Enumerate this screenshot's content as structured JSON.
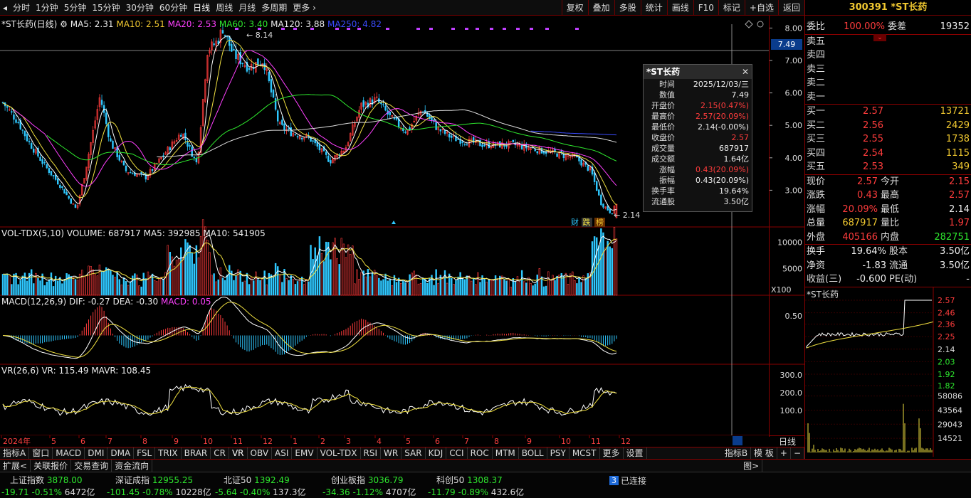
{
  "toolbar": {
    "periods": [
      "分时",
      "1分钟",
      "5分钟",
      "15分钟",
      "30分钟",
      "60分钟",
      "日线",
      "周线",
      "月线",
      "多周期",
      "更多"
    ],
    "actions": [
      "复权",
      "叠加",
      "多股",
      "统计",
      "画线",
      "F10",
      "标记",
      "+自选",
      "返回"
    ]
  },
  "chart_title": {
    "name": "*ST长药(日线)",
    "ma5": "MA5: 2.31",
    "ma10": "MA10: 2.51",
    "ma20": "MA20: 2.53",
    "ma60": "MA60: 3.40",
    "ma120": "MA120: 3.88",
    "ma250": "MA250: 4.82",
    "high_mark": "8.14",
    "low_mark": "2.14"
  },
  "price_axis": [
    "8.00",
    "7.00",
    "6.00",
    "5.00",
    "4.00",
    "3.00"
  ],
  "cursor_price": "7.49",
  "volume_label": {
    "name": "VOL-TDX(5,10)",
    "volume": "VOLUME: 687917",
    "ma5": "MA5: 392985",
    "ma10": "MA10: 541905"
  },
  "volume_axis": [
    "10000",
    "5000",
    "X100"
  ],
  "macd_label": {
    "name": "MACD(12,26,9)",
    "dif": "DIF: -0.27",
    "dea": "DEA: -0.30",
    "macd": "MACD: 0.05"
  },
  "macd_axis": [
    "0.50"
  ],
  "vr_label": {
    "name": "VR(26,6)",
    "vr": "VR: 115.49",
    "mavr": "MAVR: 108.45"
  },
  "vr_axis": [
    "300.0",
    "200.0",
    "100.0"
  ],
  "months": [
    "2024年",
    "5",
    "6",
    "7",
    "8",
    "9",
    "10",
    "11",
    "12",
    "1",
    "2",
    "3",
    "4",
    "5",
    "6",
    "7",
    "8",
    "9",
    "10",
    "11",
    "12"
  ],
  "period_badge": "日线",
  "event_badges": [
    "财",
    "跌",
    "榜"
  ],
  "tooltip": {
    "title": "*ST长药",
    "rows": [
      {
        "k": "时间",
        "v": "2025/12/03/三",
        "c": "white"
      },
      {
        "k": "数值",
        "v": "7.49",
        "c": "white"
      },
      {
        "k": "开盘价",
        "v": "2.15(0.47%)",
        "c": "red"
      },
      {
        "k": "最高价",
        "v": "2.57(20.09%)",
        "c": "red"
      },
      {
        "k": "最低价",
        "v": "2.14(-0.00%)",
        "c": "white"
      },
      {
        "k": "收盘价",
        "v": "2.57",
        "c": "red"
      },
      {
        "k": "成交量",
        "v": "687917",
        "c": "white"
      },
      {
        "k": "成交额",
        "v": "1.64亿",
        "c": "white"
      },
      {
        "k": "涨幅",
        "v": "0.43(20.09%)",
        "c": "red"
      },
      {
        "k": "振幅",
        "v": "0.43(20.09%)",
        "c": "white"
      },
      {
        "k": "换手率",
        "v": "19.64%",
        "c": "white"
      },
      {
        "k": "流通股",
        "v": "3.50亿",
        "c": "white"
      }
    ]
  },
  "quote": {
    "header": "300391 *ST长药",
    "weibi_label": "委比",
    "weibi": "100.00%",
    "weicha_label": "委差",
    "weicha": "19352",
    "sells": [
      "卖五",
      "卖四",
      "卖三",
      "卖二",
      "卖一"
    ],
    "buys": [
      {
        "l": "买一",
        "p": "2.57",
        "v": "13721"
      },
      {
        "l": "买二",
        "p": "2.56",
        "v": "2429"
      },
      {
        "l": "买三",
        "p": "2.55",
        "v": "1738"
      },
      {
        "l": "买四",
        "p": "2.54",
        "v": "1115"
      },
      {
        "l": "买五",
        "p": "2.53",
        "v": "349"
      }
    ],
    "stats": [
      {
        "l1": "现价",
        "v1": "2.57",
        "c1": "red",
        "l2": "今开",
        "v2": "2.15",
        "c2": "red"
      },
      {
        "l1": "涨跌",
        "v1": "0.43",
        "c1": "red",
        "l2": "最高",
        "v2": "2.57",
        "c2": "red"
      },
      {
        "l1": "涨幅",
        "v1": "20.09%",
        "c1": "red",
        "l2": "最低",
        "v2": "2.14",
        "c2": "white"
      },
      {
        "l1": "总量",
        "v1": "687917",
        "c1": "yel",
        "l2": "量比",
        "v2": "1.97",
        "c2": "red"
      },
      {
        "l1": "外盘",
        "v1": "405166",
        "c1": "red",
        "l2": "内盘",
        "v2": "282751",
        "c2": "green"
      }
    ],
    "stats2": [
      {
        "l1": "换手",
        "v1": "19.64%",
        "l2": "股本",
        "v2": "3.50亿"
      },
      {
        "l1": "净资",
        "v1": "-1.83",
        "l2": "流通",
        "v2": "3.50亿"
      },
      {
        "l1": "收益(三)",
        "v1": "-0.600",
        "l2": "PE(动)",
        "v2": "-"
      }
    ],
    "mini_title": "*ST长药",
    "mini_axis": [
      "2.57",
      "2.46",
      "2.36",
      "2.25",
      "2.14",
      "2.03",
      "1.92",
      "1.82"
    ],
    "mini_vol_axis": [
      "58086",
      "43564",
      "29043",
      "14521"
    ]
  },
  "indicator_tabs": [
    "指标A",
    "窗口",
    "MACD",
    "DMI",
    "DMA",
    "FSL",
    "TRIX",
    "BRAR",
    "CR",
    "VR",
    "OBV",
    "ASI",
    "EMV",
    "VOL-TDX",
    "RSI",
    "WR",
    "SAR",
    "KDJ",
    "CCI",
    "ROC",
    "MTM",
    "BOLL",
    "PSY",
    "MCST",
    "更多",
    "设置"
  ],
  "right_tabs": [
    "指标B",
    "模 板",
    "+",
    "−"
  ],
  "sub_tabs": [
    "扩展<",
    "关联报价",
    "交易查询",
    "资金流向"
  ],
  "right_sub": [
    "图>"
  ],
  "indices": [
    {
      "name": "上证指数",
      "val": "3878.00",
      "chg": "-19.71",
      "pct": "-0.51%",
      "amt": "6472亿"
    },
    {
      "name": "深证成指",
      "val": "12955.25",
      "chg": "-101.45",
      "pct": "-0.78%",
      "amt": "10228亿"
    },
    {
      "name": "北证50",
      "val": "1392.49",
      "chg": "-5.64",
      "pct": "-0.40%",
      "amt": "137.3亿"
    },
    {
      "name": "创业板指",
      "val": "3036.79",
      "chg": "-34.36",
      "pct": "-1.12%",
      "amt": "4707亿"
    },
    {
      "name": "科创50",
      "val": "1308.37",
      "chg": "-11.79",
      "pct": "-0.89%",
      "amt": "432.6亿"
    }
  ],
  "connection": {
    "count": "3",
    "label": "已连接"
  },
  "colors": {
    "up": "#ff3c3c",
    "down": "#2fc8ff",
    "ma5": "#ffffff",
    "ma10": "#f0e040",
    "ma20": "#ff40ff",
    "ma60": "#2ee82e",
    "ma120": "#dddddd",
    "ma250": "#3a4cff"
  }
}
